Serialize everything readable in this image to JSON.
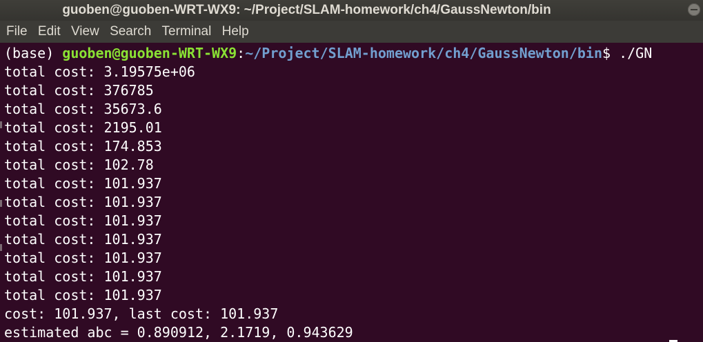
{
  "window": {
    "title": "guoben@guoben-WRT-WX9: ~/Project/SLAM-homework/ch4/GaussNewton/bin"
  },
  "menu": {
    "items": [
      "File",
      "Edit",
      "View",
      "Search",
      "Terminal",
      "Help"
    ]
  },
  "terminal": {
    "prompt": {
      "env": "(base) ",
      "user_host": "guoben@guoben-WRT-WX9",
      "colon": ":",
      "path": "~/Project/SLAM-homework/ch4/GaussNewton/bin",
      "symbol": "$ ",
      "command": "./GN"
    },
    "output_lines": [
      "total cost: 3.19575e+06",
      "total cost: 376785",
      "total cost: 35673.6",
      "total cost: 2195.01",
      "total cost: 174.853",
      "total cost: 102.78",
      "total cost: 101.937",
      "total cost: 101.937",
      "total cost: 101.937",
      "total cost: 101.937",
      "total cost: 101.937",
      "total cost: 101.937",
      "total cost: 101.937",
      "cost: 101.937, last cost: 101.937",
      "estimated abc = 0.890912, 2.1719, 0.943629"
    ]
  },
  "colors": {
    "background": "#300a24",
    "user_host": "#8ae234",
    "path": "#729fcf",
    "text": "#ffffff",
    "titlebar": "#3f3e39",
    "menubar": "#3c3b37"
  },
  "icons": {
    "minimize": "minimize-icon"
  }
}
